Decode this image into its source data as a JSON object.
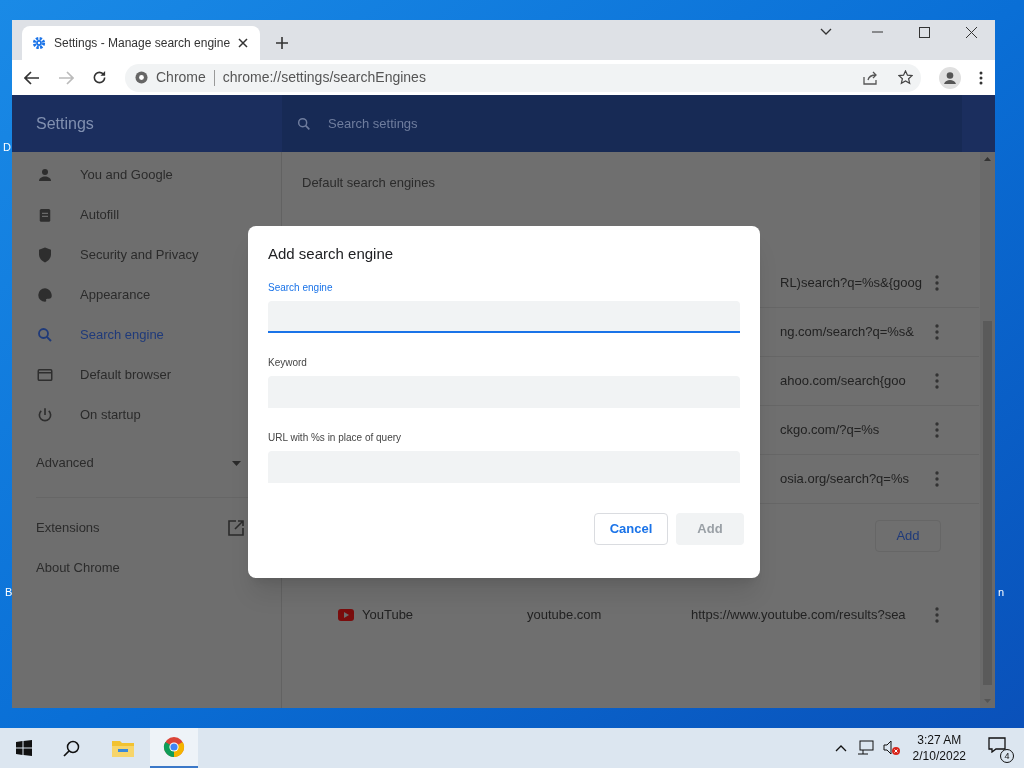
{
  "desktop_fragments": [
    "D",
    "B",
    "n"
  ],
  "browser": {
    "tab_title": "Settings - Manage search engine",
    "address_chip": "Chrome",
    "url": "chrome://settings/searchEngines"
  },
  "settings": {
    "title": "Settings",
    "search_placeholder": "Search settings",
    "nav": [
      {
        "label": "You and Google",
        "kind": "person",
        "selected": false
      },
      {
        "label": "Autofill",
        "kind": "clipboard",
        "selected": false
      },
      {
        "label": "Security and Privacy",
        "kind": "shield",
        "selected": false
      },
      {
        "label": "Appearance",
        "kind": "palette",
        "selected": false
      },
      {
        "label": "Search engine",
        "kind": "search",
        "selected": true
      },
      {
        "label": "Default browser",
        "kind": "browser",
        "selected": false
      },
      {
        "label": "On startup",
        "kind": "power",
        "selected": false
      }
    ],
    "advanced": "Advanced",
    "extensions": "Extensions",
    "about": "About Chrome"
  },
  "content": {
    "section_title": "Default search engines",
    "engine_url_fragments": [
      "RL)search?q=%s&{goog",
      "ng.com/search?q=%s&",
      "ahoo.com/search{goo",
      "ckgo.com/?q=%s",
      "osia.org/search?q=%s"
    ],
    "add_button": "Add",
    "other_engines": [
      {
        "name": "YouTube",
        "keyword": "youtube.com",
        "url": "https://www.youtube.com/results?sea"
      }
    ]
  },
  "dialog": {
    "title": "Add search engine",
    "fields": [
      {
        "label": "Search engine",
        "focused": true
      },
      {
        "label": "Keyword",
        "focused": false
      },
      {
        "label": "URL with %s in place of query",
        "focused": false
      }
    ],
    "cancel": "Cancel",
    "add": "Add"
  },
  "taskbar": {
    "time": "3:27 AM",
    "date": "2/10/2022",
    "notifications": "4"
  }
}
